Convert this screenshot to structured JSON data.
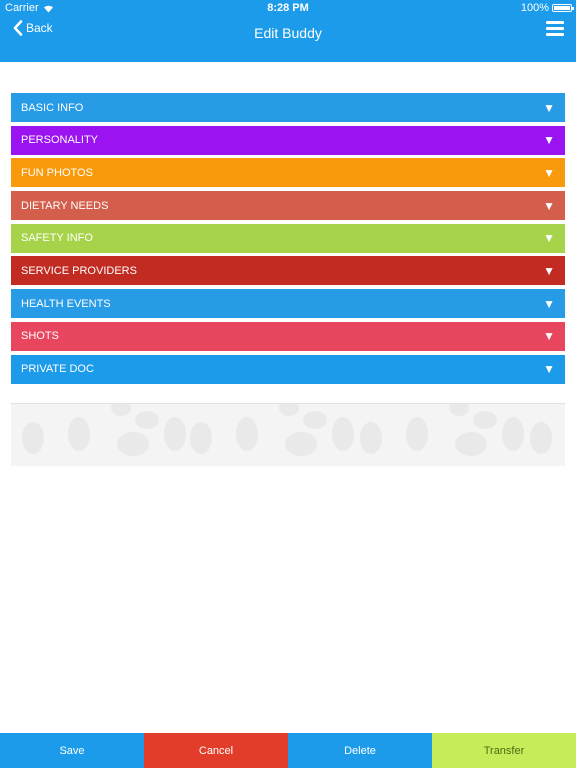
{
  "status_bar": {
    "carrier": "Carrier",
    "time": "8:28 PM",
    "battery": "100%"
  },
  "nav": {
    "back_label": "Back",
    "title": "Edit Buddy"
  },
  "sections": [
    {
      "label": "BASIC INFO",
      "color": "#279be6"
    },
    {
      "label": "PERSONALITY",
      "color": "#9a13f0"
    },
    {
      "label": "FUN PHOTOS",
      "color": "#f99a0c"
    },
    {
      "label": "DIETARY NEEDS",
      "color": "#d35e4b"
    },
    {
      "label": "SAFETY INFO",
      "color": "#a7d34a"
    },
    {
      "label": "SERVICE PROVIDERS",
      "color": "#c22b22"
    },
    {
      "label": "HEALTH EVENTS",
      "color": "#279be6"
    },
    {
      "label": "SHOTS",
      "color": "#e8465f"
    },
    {
      "label": "PRIVATE DOC",
      "color": "#1b9bea"
    }
  ],
  "expand_icon": "triangle-down-icon",
  "bottom_bar": [
    {
      "label": "Save",
      "bg": "#1b9bea",
      "fg": "#ffffff"
    },
    {
      "label": "Cancel",
      "bg": "#e23d2a",
      "fg": "#ffffff"
    },
    {
      "label": "Delete",
      "bg": "#1b9bea",
      "fg": "#ffffff"
    },
    {
      "label": "Transfer",
      "bg": "#c6ec5a",
      "fg": "#4f6a12"
    }
  ]
}
